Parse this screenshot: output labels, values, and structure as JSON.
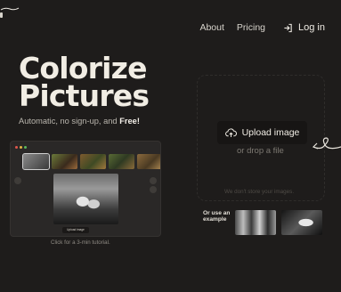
{
  "nav": {
    "about": "About",
    "pricing": "Pricing",
    "login": "Log in"
  },
  "hero": {
    "title_line1": "Colorize",
    "title_line2": "Pictures",
    "subtitle_prefix": "Automatic, no sign-up, and ",
    "subtitle_free": "Free!"
  },
  "preview": {
    "mini_upload_label": "Upload image",
    "caption": "Click for a 3-min tutorial."
  },
  "upload": {
    "button_label": "Upload image",
    "drop_text": "or drop a file",
    "privacy": "We don't store your images."
  },
  "examples": {
    "label_line1": "Or use an",
    "label_line2": "example"
  },
  "colors": {
    "background": "#1e1c1b",
    "button_bg": "#171514",
    "text_primary": "#f1ede4",
    "text_muted": "#7d7972"
  }
}
